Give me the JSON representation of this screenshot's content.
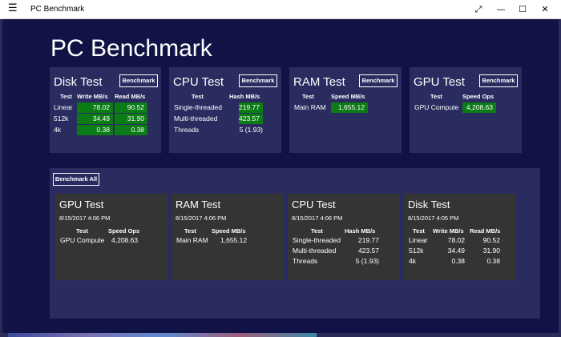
{
  "window": {
    "title": "PC Benchmark",
    "minimize_glyph": "—",
    "maximize_glyph": "☐",
    "close_glyph": "✕",
    "expand_glyph": "⤢",
    "menu_glyph": "☰"
  },
  "app": {
    "title": "PC Benchmark"
  },
  "top_cards": {
    "disk": {
      "title": "Disk Test",
      "button": "Benchmark",
      "headers": [
        "Test",
        "Write MB/s",
        "Read MB/s"
      ],
      "rows": [
        {
          "test": "Linear",
          "write": "78.02",
          "read": "90.52"
        },
        {
          "test": "512k",
          "write": "34.49",
          "read": "31.90"
        },
        {
          "test": "4k",
          "write": "0.38",
          "read": "0.38"
        }
      ]
    },
    "cpu": {
      "title": "CPU Test",
      "button": "Benchmark",
      "headers": [
        "Test",
        "Hash MB/s"
      ],
      "rows": [
        {
          "test": "Single-threaded",
          "value": "219.77"
        },
        {
          "test": "Multi-threaded",
          "value": "423.57"
        },
        {
          "test": "Threads",
          "value": "5 (1.93)"
        }
      ]
    },
    "ram": {
      "title": "RAM Test",
      "button": "Benchmark",
      "headers": [
        "Test",
        "Speed MB/s"
      ],
      "rows": [
        {
          "test": "Main RAM",
          "value": "1,655.12"
        }
      ]
    },
    "gpu": {
      "title": "GPU Test",
      "button": "Benchmark",
      "headers": [
        "Test",
        "Speed Ops"
      ],
      "rows": [
        {
          "test": "GPU Compute",
          "value": "4,208.63"
        }
      ]
    }
  },
  "benchmark_all": {
    "button": "Benchmark All"
  },
  "results": {
    "gpu": {
      "title": "GPU Test",
      "date": "8/15/2017 4:06 PM",
      "headers": [
        "Test",
        "Speed Ops"
      ],
      "rows": [
        {
          "test": "GPU Compute",
          "value": "4,208.63"
        }
      ]
    },
    "ram": {
      "title": "RAM Test",
      "date": "8/15/2017 4:06 PM",
      "headers": [
        "Test",
        "Speed MB/s"
      ],
      "rows": [
        {
          "test": "Main RAM",
          "value": "1,655.12"
        }
      ]
    },
    "cpu": {
      "title": "CPU Test",
      "date": "8/15/2017 4:06 PM",
      "headers": [
        "Test",
        "Hash MB/s"
      ],
      "rows": [
        {
          "test": "Single-threaded",
          "value": "219.77"
        },
        {
          "test": "Multi-threaded",
          "value": "423.57"
        },
        {
          "test": "Threads",
          "value": "5 (1.93)"
        }
      ]
    },
    "disk": {
      "title": "Disk Test",
      "date": "8/15/2017 4:05 PM",
      "headers": [
        "Test",
        "Write MB/s",
        "Read MB/s"
      ],
      "rows": [
        {
          "test": "Linear",
          "write": "78.02",
          "read": "90.52"
        },
        {
          "test": "512k",
          "write": "34.49",
          "read": "31.90"
        },
        {
          "test": "4k",
          "write": "0.38",
          "read": "0.38"
        }
      ]
    }
  },
  "colors": {
    "app_bg": "#111346",
    "card_bg": "#2a2c60",
    "result_card_bg": "#343434",
    "value_highlight": "#0b7b16"
  },
  "icons": {
    "menu": "hamburger-icon",
    "expand": "expand-icon",
    "minimize": "minimize-icon",
    "maximize": "maximize-icon",
    "close": "close-icon"
  }
}
